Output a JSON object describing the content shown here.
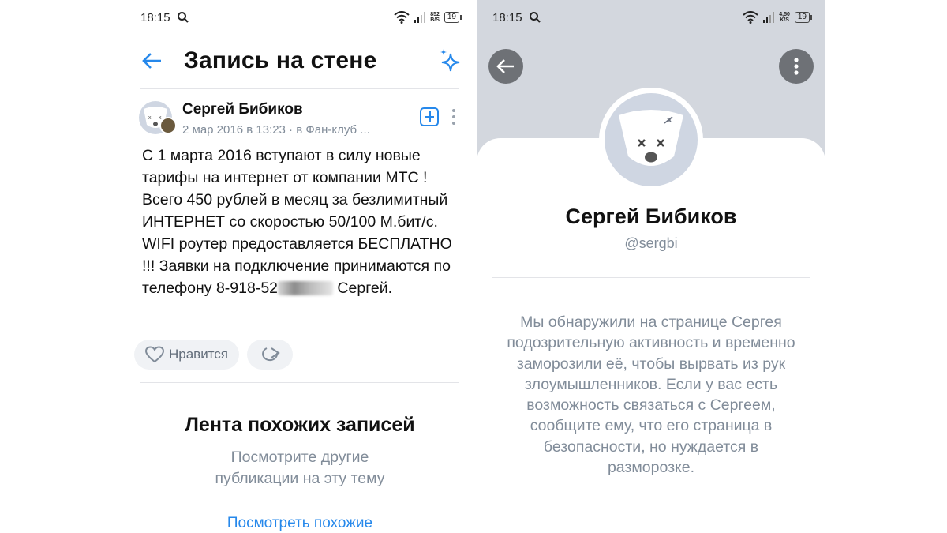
{
  "left": {
    "status": {
      "time": "18:15",
      "speed_value": "852",
      "speed_unit": "B/S",
      "battery": "19"
    },
    "header": {
      "title": "Запись на стене"
    },
    "post": {
      "author": "Сергей Бибиков",
      "meta": "2 мар 2016 в 13:23 · в Фан-клуб ...",
      "text_before_blur": "С 1 марта 2016 вступают в силу новые тарифы на интернет от компании МТС ! Всего 450 рублей в месяц за безлимитный ИНТЕРНЕТ со скоростью 50/100 М.бит/с. WIFI роутер предоставляется БЕСПЛАТНО !!! Заявки на подключение принимаются по телефону 8-918-52",
      "text_after_blur": " Сергей.",
      "like_label": "Нравится"
    },
    "feed": {
      "title": "Лента похожих записей",
      "subtitle_line1": "Посмотрите другие",
      "subtitle_line2": "публикации на эту тему",
      "link": "Посмотреть похожие"
    }
  },
  "right": {
    "status": {
      "time": "18:15",
      "speed_value": "4,50",
      "speed_unit": "K/S",
      "battery": "19"
    },
    "profile": {
      "name": "Сергей Бибиков",
      "handle": "@sergbi",
      "frozen_message": "Мы обнаружили на странице Сергея подозрительную активность и временно заморозили её, чтобы вырвать из рук злоумышленников.  Если у вас есть возможность связаться с Сергеем, сообщите ему, что его страница в безопасности, но нуждается в разморозке."
    }
  },
  "colors": {
    "accent": "#2688eb",
    "secondary_text": "#818c99",
    "cover": "#d3d7de"
  },
  "icons": [
    "search-icon",
    "wifi-icon",
    "signal-icon",
    "battery-icon",
    "back-arrow-icon",
    "sparkle-icon",
    "add-square-icon",
    "more-vertical-icon",
    "heart-icon",
    "share-icon",
    "deleted-dog-avatar-icon"
  ]
}
